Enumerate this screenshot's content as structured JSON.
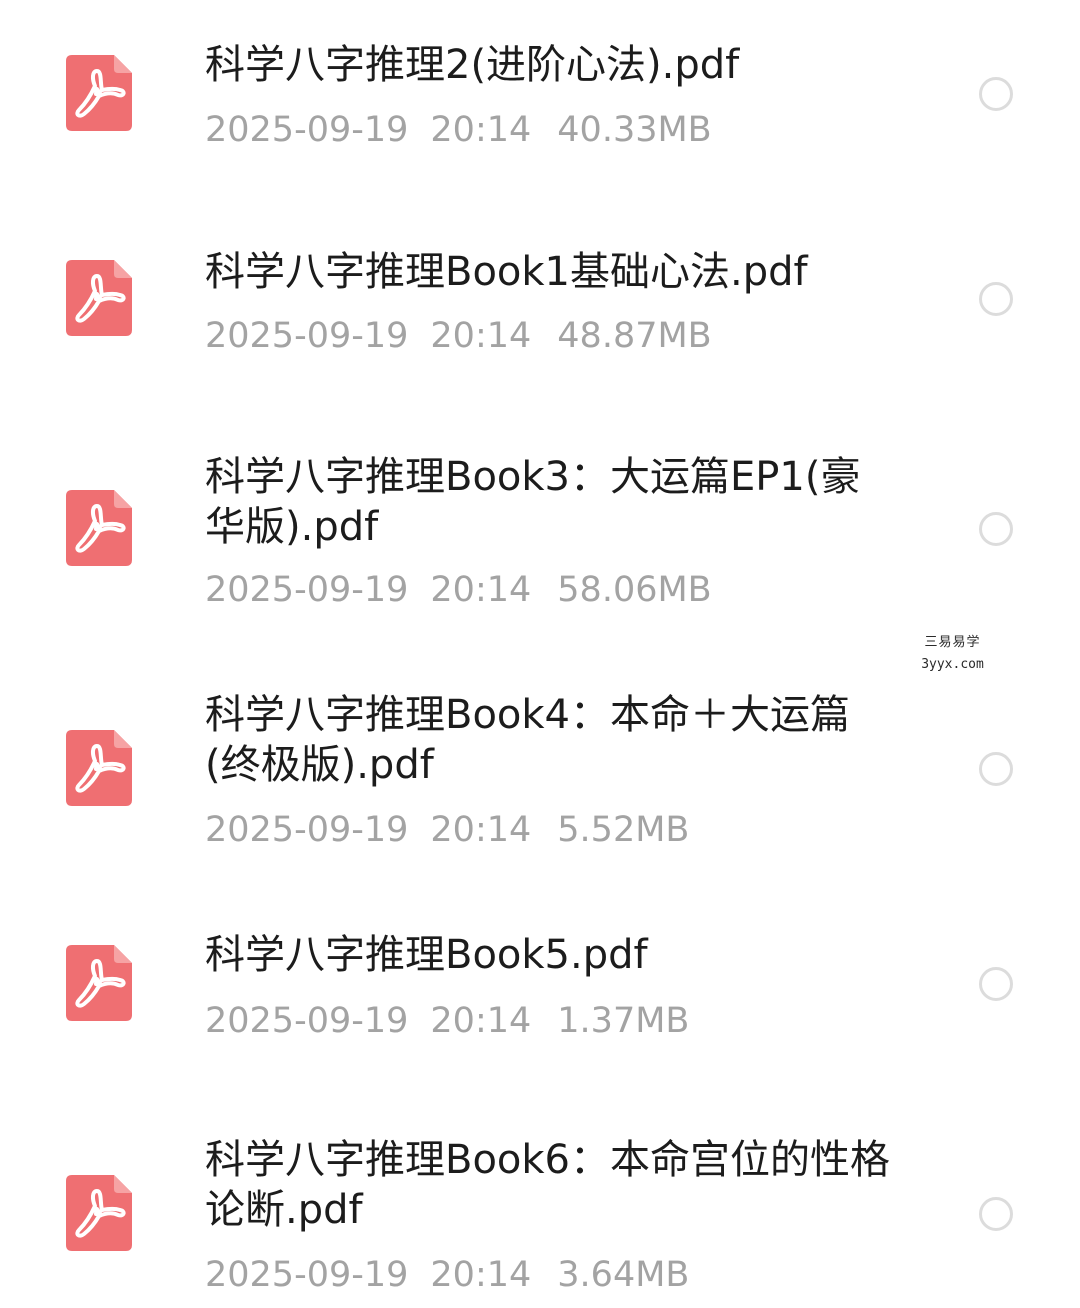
{
  "files": [
    {
      "icon": "pdf-icon",
      "name": "科学八字推理2(进阶心法).pdf",
      "date": "2025-09-19",
      "time": "20:14",
      "size": "40.33MB",
      "selected": false
    },
    {
      "icon": "pdf-icon",
      "name": "科学八字推理Book1基础心法.pdf",
      "date": "2025-09-19",
      "time": "20:14",
      "size": "48.87MB",
      "selected": false
    },
    {
      "icon": "pdf-icon",
      "name": "科学八字推理Book3：大运篇EP1(豪华版).pdf",
      "date": "2025-09-19",
      "time": "20:14",
      "size": "58.06MB",
      "selected": false
    },
    {
      "icon": "pdf-icon",
      "name": "科学八字推理Book4：本命＋大运篇(终极版).pdf",
      "date": "2025-09-19",
      "time": "20:14",
      "size": "5.52MB",
      "selected": false
    },
    {
      "icon": "pdf-icon",
      "name": "科学八字推理Book5.pdf",
      "date": "2025-09-19",
      "time": "20:14",
      "size": "1.37MB",
      "selected": false
    },
    {
      "icon": "pdf-icon",
      "name": "科学八字推理Book6：本命宫位的性格论断.pdf",
      "date": "2025-09-19",
      "time": "20:14",
      "size": "3.64MB",
      "selected": false
    }
  ],
  "watermark": {
    "line1": "三易易学",
    "line2": "3yyx.com"
  },
  "colors": {
    "icon_background": "#ef6f72",
    "icon_symbol": "#ffffff",
    "name_text": "#1c1c1c",
    "meta_text": "#a3a3a3",
    "radio_border": "#dcdcdc"
  }
}
